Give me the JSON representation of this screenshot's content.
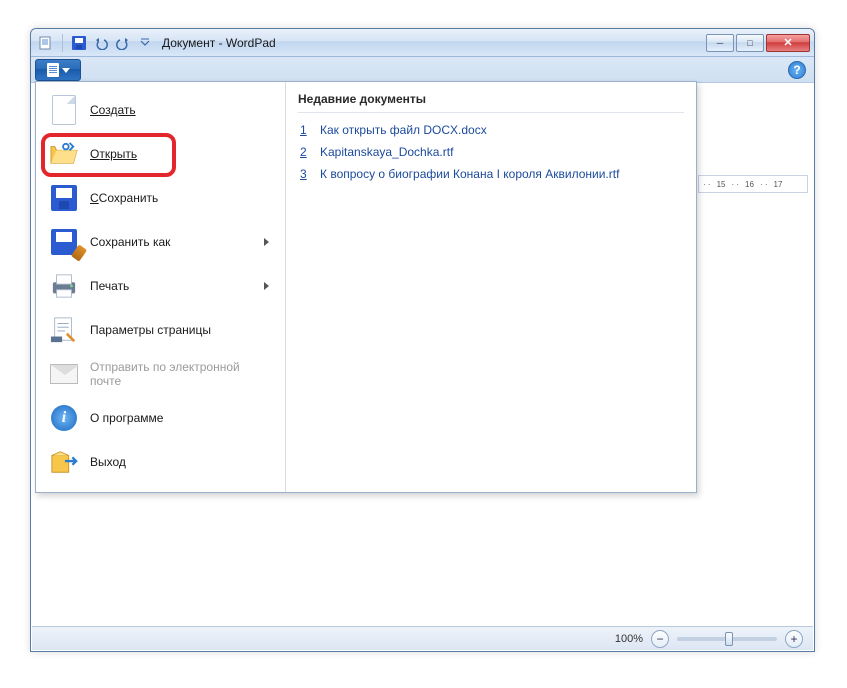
{
  "titlebar": {
    "title": "Документ - WordPad"
  },
  "menu": {
    "new": "Создать",
    "open": "Открыть",
    "save": "Сохранить",
    "saveas": "Сохранить как",
    "print": "Печать",
    "pagesetup": "Параметры страницы",
    "email": "Отправить по электронной почте",
    "about": "О программе",
    "exit": "Выход"
  },
  "recent": {
    "header": "Недавние документы",
    "items": [
      {
        "num": "1",
        "name": "Как открыть файл DOCX.docx"
      },
      {
        "num": "2",
        "name": "Kapitanskaya_Dochka.rtf"
      },
      {
        "num": "3",
        "name": "К вопросу о  биографии  Конана  I  короля  Аквилонии.rtf"
      }
    ]
  },
  "ruler": {
    "m15": "15",
    "m16": "16",
    "m17": "17"
  },
  "status": {
    "zoom": "100%"
  },
  "help": {
    "glyph": "?"
  },
  "about_glyph": "i"
}
